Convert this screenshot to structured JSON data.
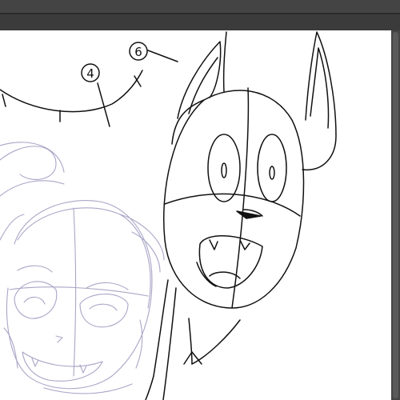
{
  "annotations": {
    "marker_four": "4",
    "marker_six": "6"
  },
  "colors": {
    "workspace": "#3b3b3b",
    "canvas": "#ffffff",
    "ink": "#111111",
    "sketch": "#a9a6c6"
  }
}
